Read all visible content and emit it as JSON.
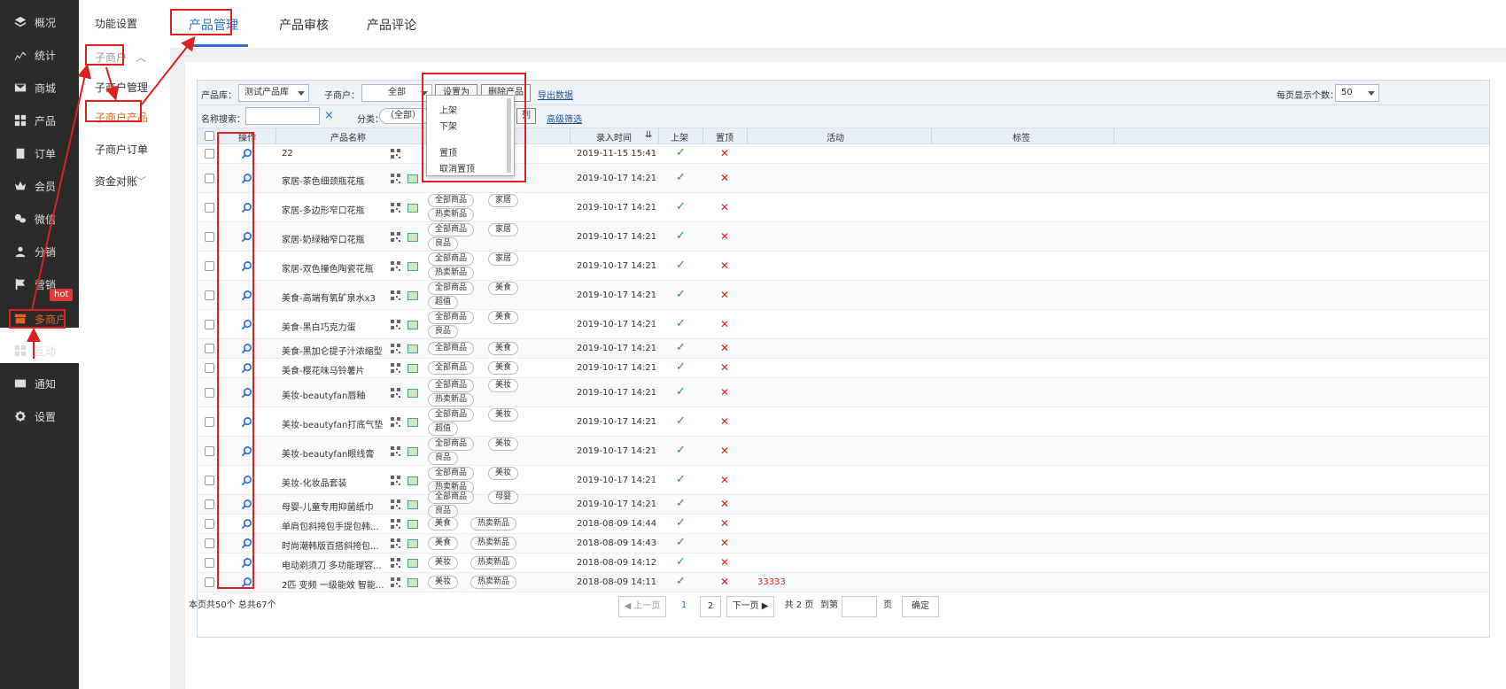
{
  "sidebar": {
    "items": [
      {
        "label": "概况",
        "icon": "layers-icon"
      },
      {
        "label": "统计",
        "icon": "chart-icon"
      },
      {
        "label": "商城",
        "icon": "mail-icon"
      },
      {
        "label": "产品",
        "icon": "grid-icon"
      },
      {
        "label": "订单",
        "icon": "clipboard-icon"
      },
      {
        "label": "会员",
        "icon": "crown-icon"
      },
      {
        "label": "微信",
        "icon": "wechat-icon"
      },
      {
        "label": "分销",
        "icon": "user-icon"
      },
      {
        "label": "营销",
        "icon": "flag-icon"
      },
      {
        "label": "多商户",
        "icon": "store-icon"
      },
      {
        "label": "互动",
        "icon": "puzzle-icon"
      },
      {
        "label": "通知",
        "icon": "envelope-icon"
      },
      {
        "label": "设置",
        "icon": "gear-icon"
      }
    ],
    "hot_badge": "hot"
  },
  "subnav": {
    "func": "功能设置",
    "sub_merchant": "子商户",
    "manage": "子商户管理",
    "products": "子商户产品",
    "orders": "子商户订单",
    "finance": "资金对账"
  },
  "tabs": [
    "产品管理",
    "产品审核",
    "产品评论"
  ],
  "toolbar": {
    "lib_label": "产品库：",
    "lib_value": "测试产品库",
    "merchant_label": "子商户：",
    "merchant_value": "全部",
    "set_btn": "设置为",
    "delete_btn": "删除产品",
    "export_link": "导出数据",
    "per_page_label": "每页显示个数：",
    "per_page_value": "50",
    "search_label": "名称搜索：",
    "clear": "×",
    "category_label": "分类：",
    "category_value": "（全部）",
    "column_btn": "列",
    "advanced_link": "高级筛选"
  },
  "dropdown": [
    "上架",
    "下架",
    "置顶",
    "取消置顶"
  ],
  "columns": {
    "op": "操作",
    "name": "产品名称",
    "time": "录入时间",
    "shelf": "上架",
    "top": "置顶",
    "activity": "活动",
    "label": "标签"
  },
  "rows": [
    {
      "name": "22",
      "tags": [],
      "time": "2019-11-15 15:41",
      "shelf": true,
      "top": false,
      "activity": ""
    },
    {
      "name": "家居-茶色细颈瓶花瓶",
      "tags": [],
      "time": "2019-10-17 14:21",
      "shelf": true,
      "top": false,
      "activity": ""
    },
    {
      "name": "家居-多边形窄口花瓶",
      "tags": [
        "全部商品",
        "家居",
        "热卖新品"
      ],
      "time": "2019-10-17 14:21",
      "shelf": true,
      "top": false,
      "activity": ""
    },
    {
      "name": "家居-奶绿釉窄口花瓶",
      "tags": [
        "全部商品",
        "家居",
        "良品"
      ],
      "time": "2019-10-17 14:21",
      "shelf": true,
      "top": false,
      "activity": ""
    },
    {
      "name": "家居-双色撞色陶瓷花瓶",
      "tags": [
        "全部商品",
        "家居",
        "热卖新品"
      ],
      "time": "2019-10-17 14:21",
      "shelf": true,
      "top": false,
      "activity": ""
    },
    {
      "name": "美食-高端有氧矿泉水x3",
      "tags": [
        "全部商品",
        "美食",
        "超值"
      ],
      "time": "2019-10-17 14:21",
      "shelf": true,
      "top": false,
      "activity": ""
    },
    {
      "name": "美食-黑白巧克力蛋",
      "tags": [
        "全部商品",
        "美食",
        "良品"
      ],
      "time": "2019-10-17 14:21",
      "shelf": true,
      "top": false,
      "activity": ""
    },
    {
      "name": "美食-黑加仑提子汁浓缩型",
      "tags": [
        "全部商品",
        "美食"
      ],
      "time": "2019-10-17 14:21",
      "shelf": true,
      "top": false,
      "activity": ""
    },
    {
      "name": "美食-樱花味马铃薯片",
      "tags": [
        "全部商品",
        "美食"
      ],
      "time": "2019-10-17 14:21",
      "shelf": true,
      "top": false,
      "activity": ""
    },
    {
      "name": "美妆-beautyfan唇釉",
      "tags": [
        "全部商品",
        "美妆",
        "热卖新品"
      ],
      "time": "2019-10-17 14:21",
      "shelf": true,
      "top": false,
      "activity": ""
    },
    {
      "name": "美妆-beautyfan打底气垫",
      "tags": [
        "全部商品",
        "美妆",
        "超值"
      ],
      "time": "2019-10-17 14:21",
      "shelf": true,
      "top": false,
      "activity": ""
    },
    {
      "name": "美妆-beautyfan眼线膏",
      "tags": [
        "全部商品",
        "美妆",
        "良品"
      ],
      "time": "2019-10-17 14:21",
      "shelf": true,
      "top": false,
      "activity": ""
    },
    {
      "name": "美妆-化妆品套装",
      "tags": [
        "全部商品",
        "美妆",
        "热卖新品"
      ],
      "time": "2019-10-17 14:21",
      "shelf": true,
      "top": false,
      "activity": ""
    },
    {
      "name": "母婴-儿童专用抑菌纸巾",
      "tags": [
        "全部商品",
        "母婴",
        "良品"
      ],
      "time": "2019-10-17 14:21",
      "shelf": true,
      "top": false,
      "activity": ""
    },
    {
      "name": "单肩包斜挎包手提包韩...",
      "tags": [
        "美食",
        "热卖新品"
      ],
      "time": "2018-08-09 14:44",
      "shelf": true,
      "top": false,
      "activity": ""
    },
    {
      "name": "时尚潮韩版百搭斜挎包...",
      "tags": [
        "美食",
        "热卖新品"
      ],
      "time": "2018-08-09 14:43",
      "shelf": true,
      "top": false,
      "activity": ""
    },
    {
      "name": "电动剃须刀 多功能理容...",
      "tags": [
        "美妆",
        "热卖新品"
      ],
      "time": "2018-08-09 14:12",
      "shelf": true,
      "top": false,
      "activity": ""
    },
    {
      "name": "2匹 变频 一级能效 智能...",
      "tags": [
        "美妆",
        "热卖新品"
      ],
      "time": "2018-08-09 14:11",
      "shelf": true,
      "top": false,
      "activity": "33333"
    }
  ],
  "footer": {
    "count": "本页共50个 总共67个",
    "prev": "◀ 上一页",
    "page1": "1",
    "page2": "2",
    "next": "下一页 ▶",
    "total_pages": "共 2 页",
    "goto": "到第",
    "page_unit": "页",
    "confirm": "确定"
  }
}
